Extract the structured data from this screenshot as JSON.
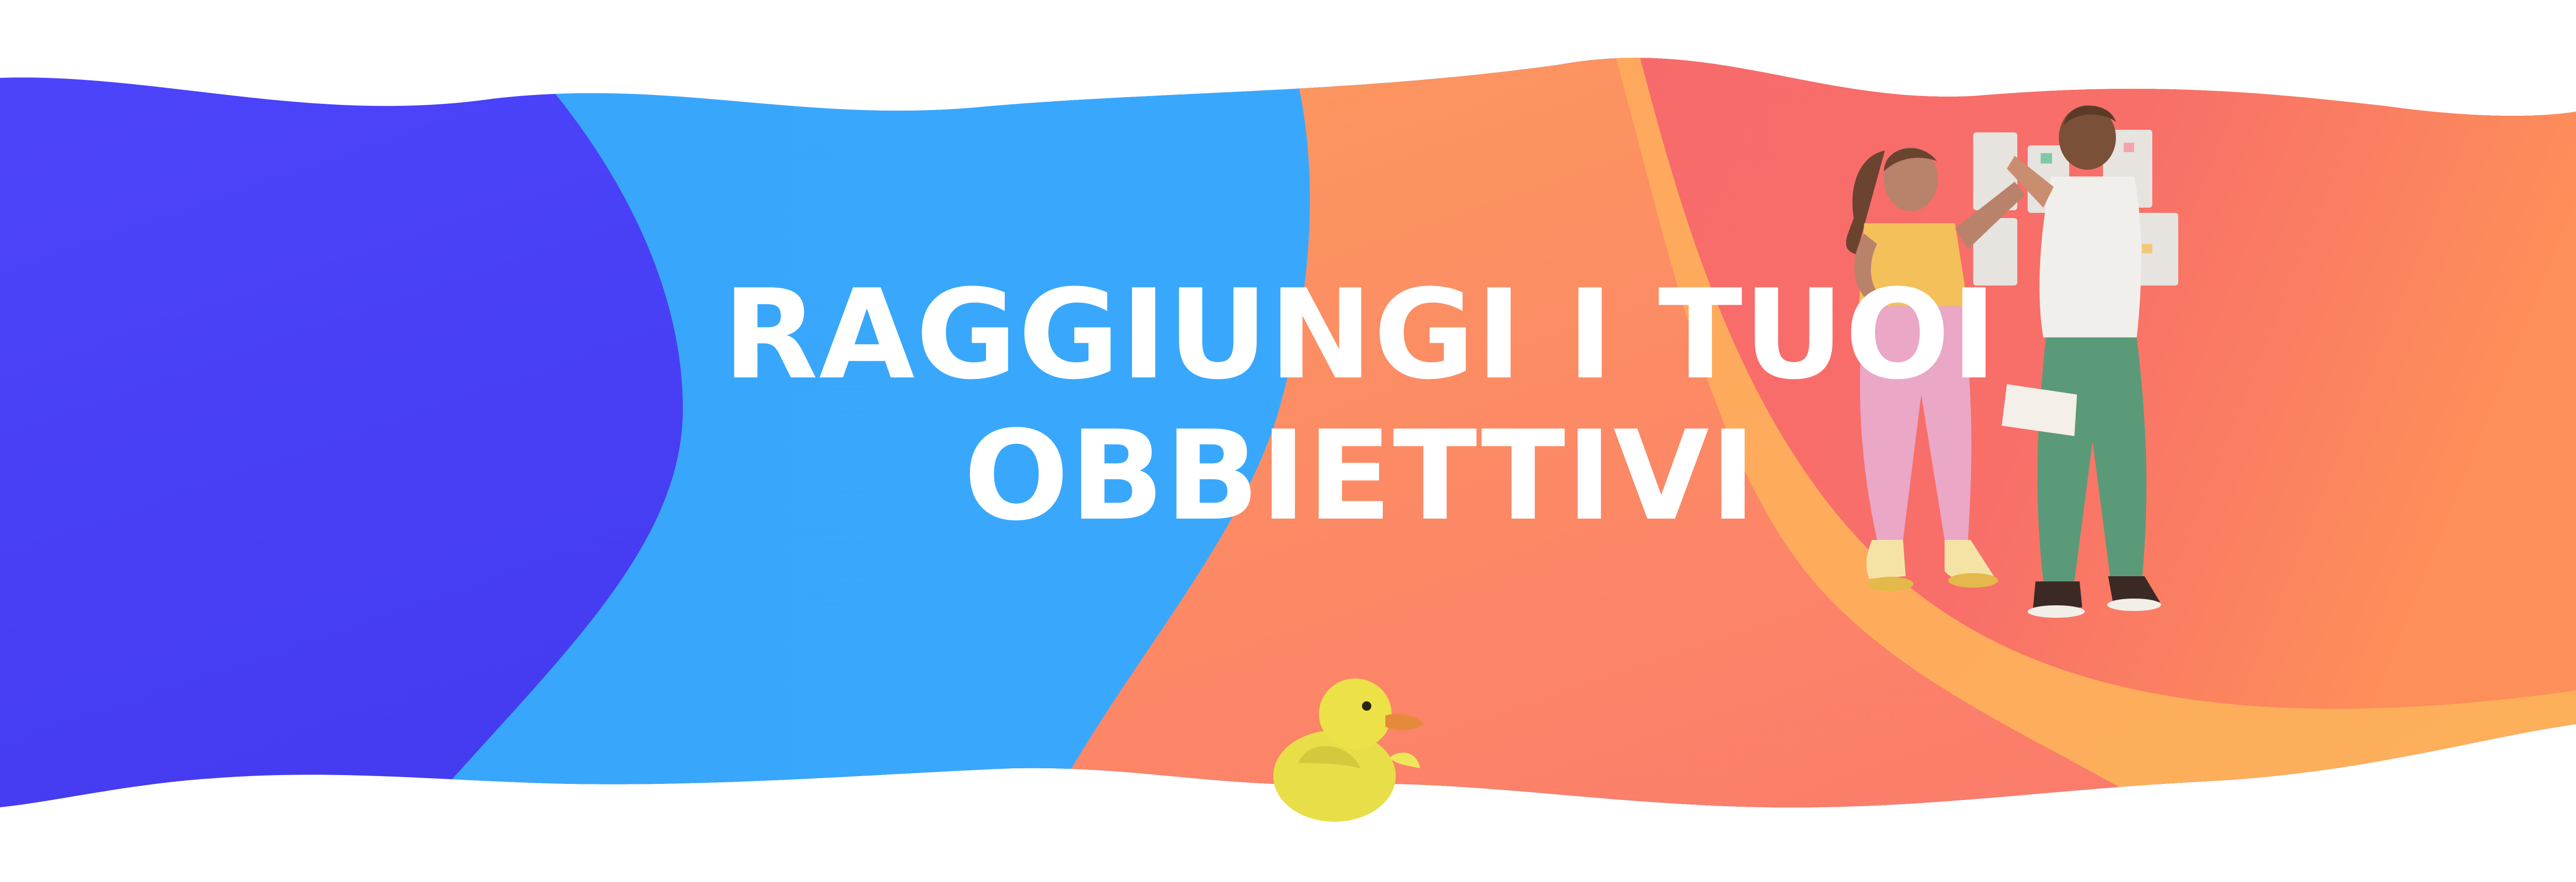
{
  "banner": {
    "headline_line1": "RAGGIUNGI I TUOI",
    "headline_line2": "OBBIETTIVI"
  },
  "colors": {
    "indigo": "#4a40fb",
    "sky": "#3aa8fb",
    "orange": "#fd8a64",
    "coral": "#f76d6a",
    "amber": "#fdab5b",
    "text": "#ffffff",
    "duck": "#e9e04a"
  },
  "illustration": {
    "subject": "two-people-planning-at-board",
    "mascot": "rubber-duck"
  }
}
